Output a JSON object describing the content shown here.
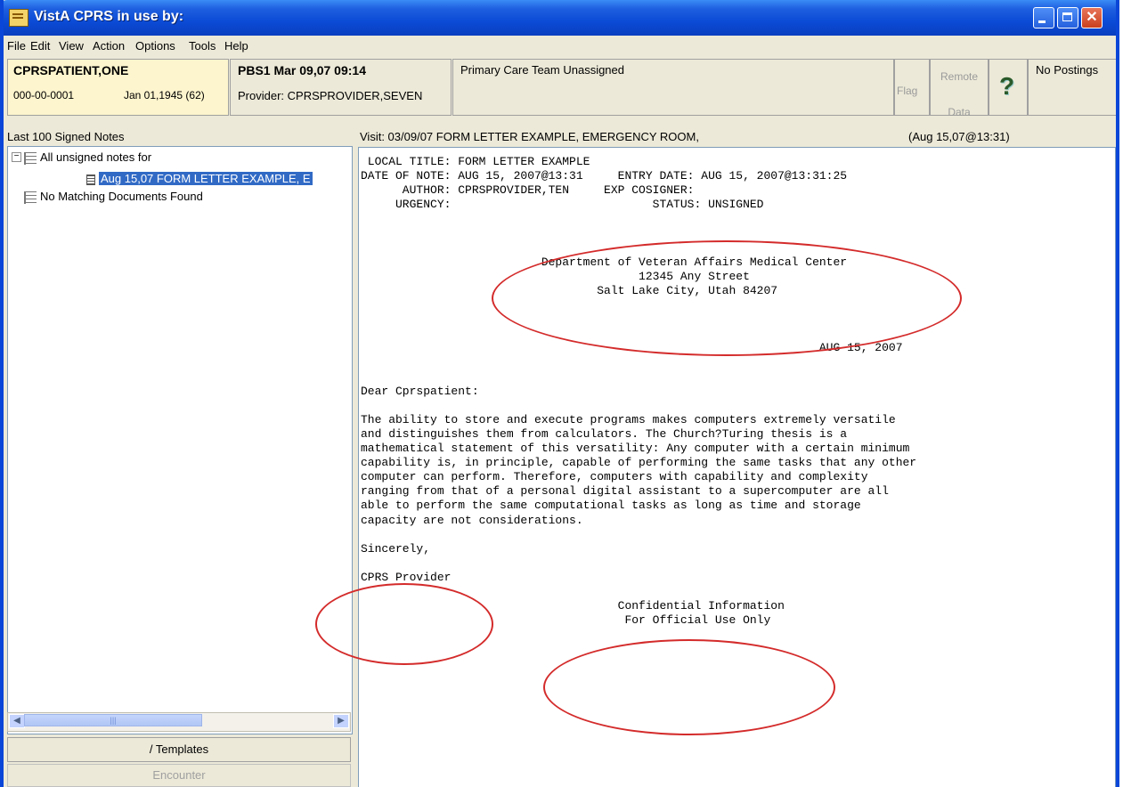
{
  "window": {
    "title": "VistA CPRS in use by:"
  },
  "menu": [
    "File",
    "Edit",
    "View",
    "Action",
    "Options",
    "Tools",
    "Help"
  ],
  "patient": {
    "name": "CPRSPATIENT,ONE",
    "ssn": "000-00-0001",
    "dob": "Jan 01,1945 (62)"
  },
  "encounter": {
    "location": "PBS1 Mar 09,07 09:14",
    "provider": "Provider: CPRSPROVIDER,SEVEN"
  },
  "team": "Primary Care Team Unassigned",
  "buttons": {
    "flag": "Flag",
    "remote_line1": "Remote",
    "remote_line2": "Data",
    "help": "?",
    "postings": "No Postings"
  },
  "left": {
    "label": "Last 100 Signed Notes",
    "tree": [
      {
        "expander": "−",
        "text": "All unsigned notes for"
      },
      {
        "text": "Aug 15,07 FORM LETTER EXAMPLE, E",
        "selected": true
      },
      {
        "text": "No Matching Documents Found"
      }
    ],
    "templates_button": "/ Templates",
    "encounter_button": "Encounter"
  },
  "visit": {
    "text": "Visit: 03/09/07  FORM LETTER EXAMPLE, EMERGENCY ROOM,",
    "timestamp": "(Aug 15,07@13:31)"
  },
  "note_lines": [
    " LOCAL TITLE: FORM LETTER EXAMPLE",
    "DATE OF NOTE: AUG 15, 2007@13:31     ENTRY DATE: AUG 15, 2007@13:31:25",
    "      AUTHOR: CPRSPROVIDER,TEN     EXP COSIGNER:",
    "     URGENCY:                             STATUS: UNSIGNED",
    "",
    "",
    "",
    "                          Department of Veteran Affairs Medical Center",
    "                                        12345 Any Street",
    "                                  Salt Lake City, Utah 84207",
    "",
    "",
    "",
    "                                                                  AUG 15, 2007",
    "",
    "",
    "Dear Cprspatient:",
    "",
    "The ability to store and execute programs makes computers extremely versatile",
    "and distinguishes them from calculators. The Church?Turing thesis is a",
    "mathematical statement of this versatility: Any computer with a certain minimum",
    "capability is, in principle, capable of performing the same tasks that any other",
    "computer can perform. Therefore, computers with capability and complexity",
    "ranging from that of a personal digital assistant to a supercomputer are all",
    "able to perform the same computational tasks as long as time and storage",
    "capacity are not considerations.",
    "",
    "Sincerely,",
    "",
    "CPRS Provider",
    "",
    "                                     Confidential Information",
    "                                      For Official Use Only"
  ],
  "colors": {
    "annotation": "#d42b2b",
    "selection": "#316ac5",
    "patient_bg": "#fdf5cd"
  }
}
